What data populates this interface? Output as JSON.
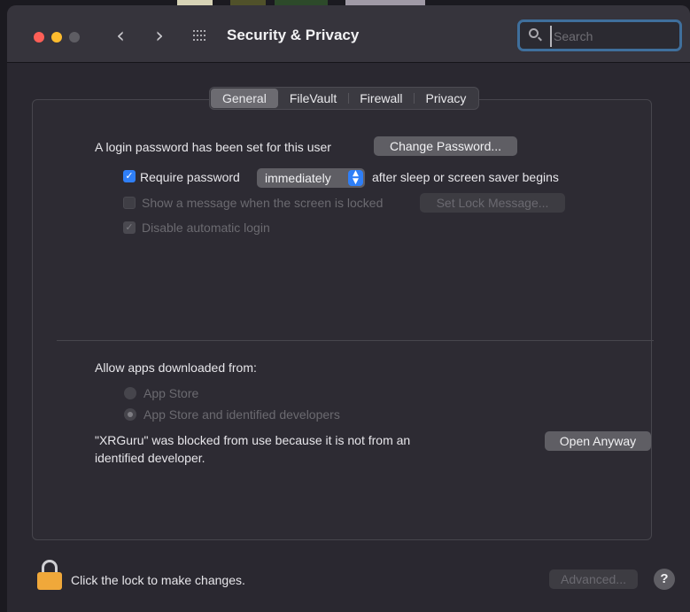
{
  "window": {
    "title": "Security & Privacy",
    "icons": {
      "back": "chevron-left-icon",
      "forward": "chevron-right-icon",
      "all_prefs": "grid-icon",
      "search": "search-icon",
      "lock": "lock-icon",
      "help": "help-icon"
    }
  },
  "search": {
    "placeholder": "Search"
  },
  "tabs": [
    {
      "label": "General",
      "active": true
    },
    {
      "label": "FileVault",
      "active": false
    },
    {
      "label": "Firewall",
      "active": false
    },
    {
      "label": "Privacy",
      "active": false
    }
  ],
  "general": {
    "login_password_text": "A login password has been set for this user",
    "change_password_label": "Change Password...",
    "require_password": {
      "label": "Require password",
      "checked": true
    },
    "require_password_select": "immediately",
    "after_sleep_text": "after sleep or screen saver begins",
    "show_message": {
      "label": "Show a message when the screen is locked",
      "checked": false,
      "disabled": true
    },
    "set_lock_message_label": "Set Lock Message...",
    "disable_auto_login": {
      "label": "Disable automatic login",
      "checked": true,
      "disabled": true
    }
  },
  "apps": {
    "heading": "Allow apps downloaded from:",
    "options": [
      {
        "label": "App Store",
        "selected": false
      },
      {
        "label": "App Store and identified developers",
        "selected": true
      }
    ],
    "blocked_line1": "\"XRGuru\" was blocked from use because it is not from an",
    "blocked_line2": "identified developer.",
    "open_anyway_label": "Open Anyway"
  },
  "footer": {
    "lock_text": "Click the lock to make changes.",
    "advanced_label": "Advanced...",
    "help_label": "?"
  },
  "colors": {
    "accent": "#2f7ff7",
    "close": "#fe5f57",
    "minimize": "#febc2e",
    "lock": "#f0a83a",
    "search_focus": "#3f6f9c"
  }
}
